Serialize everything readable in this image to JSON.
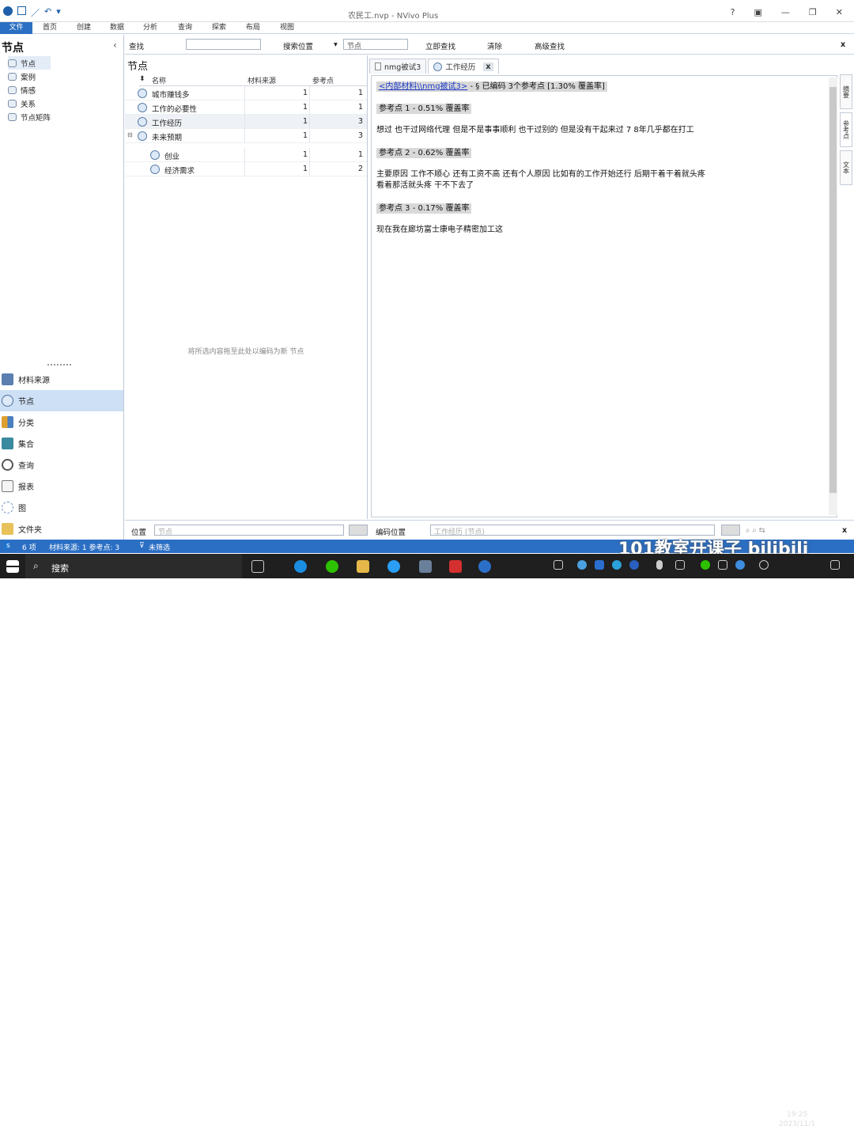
{
  "app": {
    "title": "农民工.nvp - NVivo Plus",
    "qat_undo": "↶",
    "qat_more": "▾"
  },
  "window": {
    "help": "?",
    "restore": "▣",
    "min": "—",
    "max": "❐",
    "close": "✕"
  },
  "ribbon": {
    "tabs": [
      "文件",
      "首页",
      "创建",
      "数据",
      "分析",
      "查询",
      "探索",
      "布局",
      "视图"
    ]
  },
  "left": {
    "title": "节点",
    "collapse": "‹",
    "tree": [
      "节点",
      "案例",
      "情感",
      "关系",
      "节点矩阵"
    ],
    "nav": [
      "材料来源",
      "节点",
      "分类",
      "集合",
      "查询",
      "报表",
      "图",
      "文件夹"
    ]
  },
  "search": {
    "find_label": "查找",
    "find_value": "",
    "location_label": "搜索位置",
    "location_arrow": "▾",
    "location_value": "节点",
    "find_now": "立即查找",
    "clear": "清除",
    "advanced": "高级查找",
    "close": "x"
  },
  "nodes": {
    "title": "节点",
    "columns": [
      "名称",
      "材料来源",
      "参考点"
    ],
    "rows": [
      {
        "name": "城市赚钱多",
        "sources": "1",
        "refs": "1"
      },
      {
        "name": "工作的必要性",
        "sources": "1",
        "refs": "1"
      },
      {
        "name": "工作经历",
        "sources": "1",
        "refs": "3"
      },
      {
        "name": "未来预期",
        "sources": "1",
        "refs": "3"
      },
      {
        "name": "创业",
        "sources": "1",
        "refs": "1"
      },
      {
        "name": "经济需求",
        "sources": "1",
        "refs": "2"
      }
    ],
    "drop_hint": "将所选内容拖至此处以编码为新 节点"
  },
  "doc": {
    "tabs": [
      {
        "label": "nmg被试3"
      },
      {
        "label": "工作经历",
        "close": "x"
      }
    ],
    "header_link": "<内部材料\\\\nmg被试3>",
    "header_rest": " - § 已编码 3个参考点 [1.30% 覆盖率]",
    "ref1": "参考点 1 - 0.51% 覆盖率",
    "text1": "想过 也干过网络代理  但是不是事事顺利 也干过别的  但是没有干起来过  7  8年几乎都在打工",
    "ref2": "参考点 2 - 0.62% 覆盖率",
    "text2a": "主要原因  工作不顺心  还有工资不高  还有个人原因    比如有的工作开始还行    后期干着干着就头疼",
    "text2b": "看着那活就头疼  干不下去了",
    "ref3": "参考点 3 - 0.17% 覆盖率",
    "text3": "现在我在廊坊富士康电子精密加工这",
    "side_tabs": [
      "摘要",
      "参考点",
      "文本"
    ]
  },
  "bottom": {
    "location_label": "位置",
    "location_value": "节点",
    "code_label": "编码位置",
    "code_value": "工作经历 (节点)",
    "close": "x"
  },
  "status": {
    "items_prefix": "s",
    "count": "6 项",
    "stats": "材料来源: 1   参考点: 3",
    "filter": "未筛选"
  },
  "taskbar": {
    "search": "搜索",
    "time": "19:25",
    "date": "2023/11/1"
  },
  "watermark": "101教室开课子 bilibili"
}
